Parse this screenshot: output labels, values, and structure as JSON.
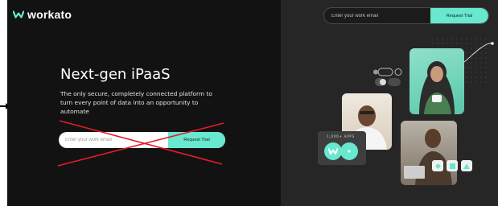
{
  "brand": {
    "name": "workato",
    "accent": "#67e8cf"
  },
  "header": {
    "email_placeholder": "Enter your work email",
    "cta_label": "Request Trial"
  },
  "hero": {
    "title": "Next-gen iPaaS",
    "subtitle": "The only secure, completely connected platform to turn every point of data into an opportunity to automate",
    "email_placeholder": "Enter your work email",
    "cta_label": "Request Trial"
  },
  "collage": {
    "apps_label": "1,000+ APPS"
  }
}
